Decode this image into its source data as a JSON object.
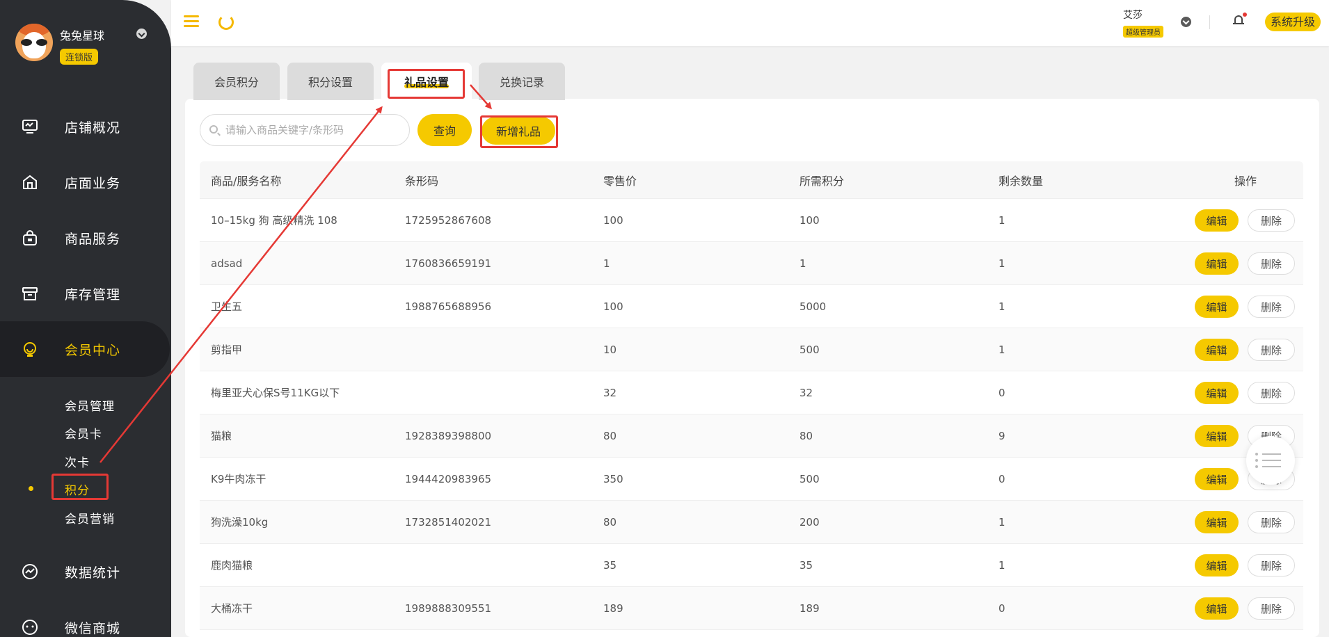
{
  "brand": {
    "name": "兔兔星球",
    "badge": "连锁版"
  },
  "sidebar": {
    "items": [
      {
        "label": "店铺概况",
        "icon": "monitor-icon"
      },
      {
        "label": "店面业务",
        "icon": "store-icon"
      },
      {
        "label": "商品服务",
        "icon": "bag-icon"
      },
      {
        "label": "库存管理",
        "icon": "box-icon"
      },
      {
        "label": "会员中心",
        "icon": "member-icon"
      },
      {
        "label": "数据统计",
        "icon": "chart-icon"
      },
      {
        "label": "微信商城",
        "icon": "wechat-icon"
      }
    ],
    "sub_items": [
      "会员管理",
      "会员卡",
      "次卡",
      "积分",
      "会员营销"
    ]
  },
  "header": {
    "user_name": "艾莎",
    "user_role": "超级管理员",
    "upgrade": "系统升级"
  },
  "tabs": [
    "会员积分",
    "积分设置",
    "礼品设置",
    "兑换记录"
  ],
  "search": {
    "placeholder": "请输入商品关键字/条形码",
    "query_label": "查询",
    "add_label": "新增礼品"
  },
  "table": {
    "columns": [
      "商品/服务名称",
      "条形码",
      "零售价",
      "所需积分",
      "剩余数量",
      "操作"
    ],
    "edit_label": "编辑",
    "delete_label": "删除",
    "rows": [
      [
        "10–15kg 狗 高级精洗 108",
        "1725952867608",
        "100",
        "100",
        "1"
      ],
      [
        "adsad",
        "1760836659191",
        "1",
        "1",
        "1"
      ],
      [
        "卫生五",
        "1988765688956",
        "100",
        "5000",
        "1"
      ],
      [
        "剪指甲",
        "",
        "10",
        "500",
        "1"
      ],
      [
        "梅里亚犬心保S号11KG以下",
        "",
        "32",
        "32",
        "0"
      ],
      [
        "猫粮",
        "1928389398800",
        "80",
        "80",
        "9"
      ],
      [
        "K9牛肉冻干",
        "1944420983965",
        "350",
        "500",
        "0"
      ],
      [
        "狗洗澡10kg",
        "1732851402021",
        "80",
        "200",
        "1"
      ],
      [
        "鹿肉猫粮",
        "",
        "35",
        "35",
        "1"
      ],
      [
        "大桶冻干",
        "1989888309551",
        "189",
        "189",
        "0"
      ]
    ]
  },
  "colors": {
    "accent": "#f5c900",
    "sidebar_bg": "#2b2d31",
    "annotation": "#e53935"
  }
}
